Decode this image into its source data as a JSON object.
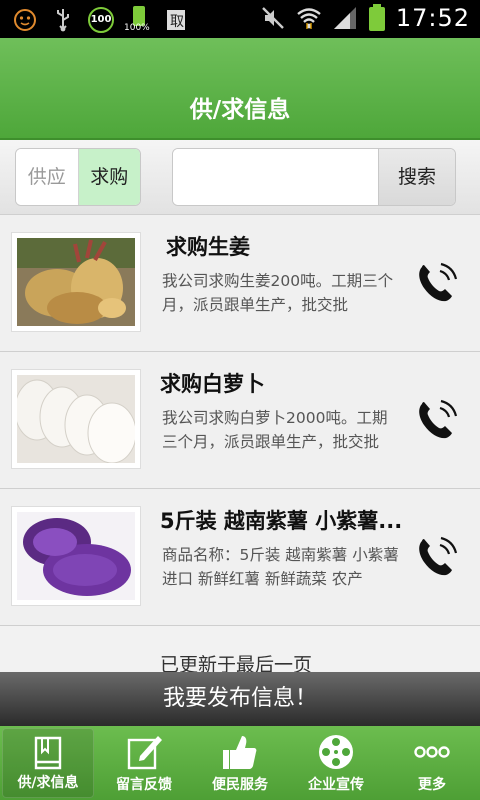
{
  "status_bar": {
    "time": "17:52",
    "battery_percent_label": "100%",
    "badge_100": "100"
  },
  "header": {
    "title": "供/求信息"
  },
  "filter": {
    "supply_label": "供应",
    "buy_label": "求购",
    "selected": "求购"
  },
  "search": {
    "placeholder": "",
    "value": "",
    "button_label": "搜索"
  },
  "list": [
    {
      "title": "求购生姜",
      "desc": "我公司求购生姜200吨。工期三个月，派员跟单生产，批交批",
      "image": "ginger"
    },
    {
      "title": "求购白萝卜",
      "desc": "我公司求购白萝卜2000吨。工期三个月，派员跟单生产，批交批",
      "image": "white-radish"
    },
    {
      "title": "5斤装 越南紫薯 小紫薯...",
      "desc": "商品名称：5斤装 越南紫薯 小紫薯 进口 新鲜红薯 新鲜蔬菜 农产",
      "image": "purple-sweet-potato"
    }
  ],
  "list_footer": "已更新于最后一页",
  "publish_label": "我要发布信息！",
  "bottom_nav": [
    {
      "label": "供/求信息",
      "icon": "book-icon",
      "active": true
    },
    {
      "label": "留言反馈",
      "icon": "edit-icon",
      "active": false
    },
    {
      "label": "便民服务",
      "icon": "thumbs-up-icon",
      "active": false
    },
    {
      "label": "企业宣传",
      "icon": "film-reel-icon",
      "active": false
    },
    {
      "label": "更多",
      "icon": "more-dots-icon",
      "active": false
    }
  ],
  "colors": {
    "brand_green": "#4ea73a",
    "selected_segment": "#c7f1c9"
  }
}
